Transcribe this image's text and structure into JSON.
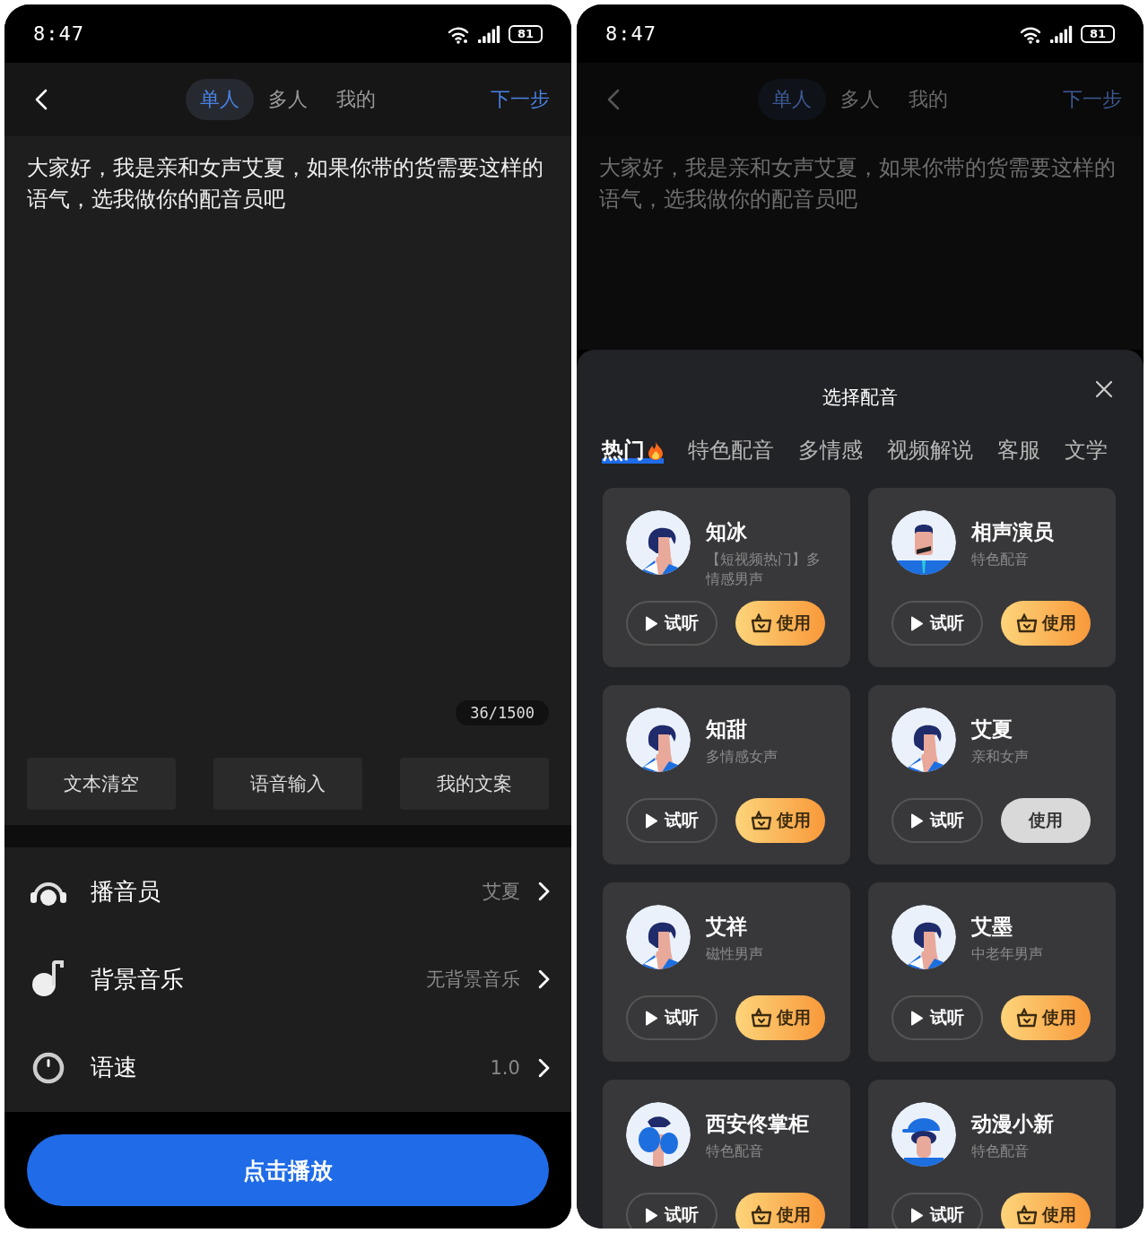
{
  "left_screen": {
    "status_bar": {
      "time": "8:47",
      "battery": "81"
    },
    "header": {
      "tabs": [
        {
          "label": "单人",
          "selected": true
        },
        {
          "label": "多人",
          "selected": false
        },
        {
          "label": "我的",
          "selected": false
        }
      ],
      "next": "下一步"
    },
    "editor": {
      "text": "大家好，我是亲和女声艾夏，如果你带的货需要这样的语气，选我做你的配音员吧",
      "counter": "36/1500",
      "actions": [
        "文本清空",
        "语音输入",
        "我的文案"
      ]
    },
    "settings": [
      {
        "kind": "announcer",
        "label": "播音员",
        "value": "艾夏"
      },
      {
        "kind": "music",
        "label": "背景音乐",
        "value": "无背景音乐"
      },
      {
        "kind": "speed",
        "label": "语速",
        "value": "1.0"
      }
    ],
    "play_button": "点击播放"
  },
  "right_screen": {
    "status_bar": {
      "time": "8:47",
      "battery": "81"
    },
    "header": {
      "tabs": [
        {
          "label": "单人",
          "selected": true
        },
        {
          "label": "多人",
          "selected": false
        },
        {
          "label": "我的",
          "selected": false
        }
      ],
      "next": "下一步"
    },
    "editor": {
      "text": "大家好，我是亲和女声艾夏，如果你带的货需要这样的语气，选我做你的配音员吧"
    },
    "sheet": {
      "title": "选择配音",
      "categories": [
        {
          "label": "热门",
          "hot": true,
          "selected": true
        },
        {
          "label": "特色配音",
          "hot": false,
          "selected": false
        },
        {
          "label": "多情感",
          "hot": false,
          "selected": false
        },
        {
          "label": "视频解说",
          "hot": false,
          "selected": false
        },
        {
          "label": "客服",
          "hot": false,
          "selected": false
        },
        {
          "label": "文学",
          "hot": false,
          "selected": false
        }
      ],
      "voices": [
        {
          "name": "知冰",
          "description": "【短视频热门】多情感男声",
          "kind": "plain",
          "preview": "试听",
          "use": "使用",
          "current": false
        },
        {
          "name": "相声演员",
          "description": "特色配音",
          "kind": "suit",
          "preview": "试听",
          "use": "使用",
          "current": false
        },
        {
          "name": "知甜",
          "description": "多情感女声",
          "kind": "plain",
          "preview": "试听",
          "use": "使用",
          "current": false
        },
        {
          "name": "艾夏",
          "description": "亲和女声",
          "kind": "plain",
          "preview": "试听",
          "use": "使用",
          "current": true
        },
        {
          "name": "艾祥",
          "description": "磁性男声",
          "kind": "plain",
          "preview": "试听",
          "use": "使用",
          "current": false
        },
        {
          "name": "艾墨",
          "description": "中老年男声",
          "kind": "plain",
          "preview": "试听",
          "use": "使用",
          "current": false
        },
        {
          "name": "西安佟掌柜",
          "description": "特色配音",
          "kind": "curly",
          "preview": "试听",
          "use": "使用",
          "current": false
        },
        {
          "name": "动漫小新",
          "description": "特色配音",
          "kind": "cap",
          "preview": "试听",
          "use": "使用",
          "current": false
        }
      ]
    }
  }
}
